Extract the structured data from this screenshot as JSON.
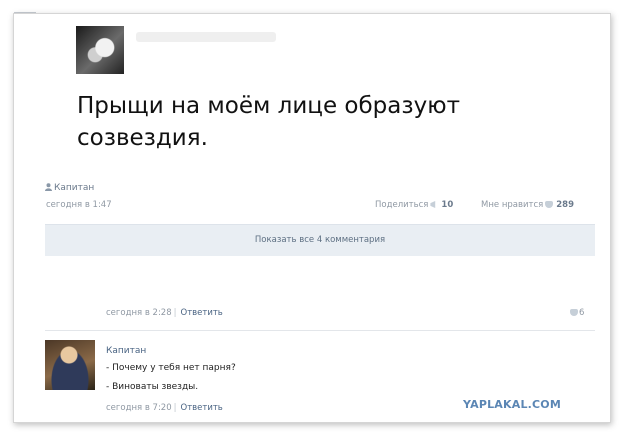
{
  "post": {
    "text": "Прыщи на моём лице образуют созвездия.",
    "author": "Капитан",
    "time": "сегодня в 1:47",
    "share_label": "Поделиться",
    "share_count": "10",
    "like_label": "Мне нравится",
    "like_count": "289"
  },
  "comments_bar": {
    "label": "Показать все 4 комментария"
  },
  "comment1": {
    "time": "сегодня в 2:28",
    "reply_label": "Ответить",
    "likes": "6"
  },
  "comment2": {
    "author": "Капитан",
    "line1": "- Почему у тебя нет парня?",
    "line2": "- Виноваты звезды.",
    "time": "сегодня в 7:20",
    "reply_label": "Ответить"
  },
  "watermark": {
    "text": "YAPLAKAL.COM"
  },
  "colors": {
    "link": "#4a6483",
    "meta": "#8f98a3",
    "bar_bg": "#e9eef3",
    "watermark": "#5b86b4"
  }
}
